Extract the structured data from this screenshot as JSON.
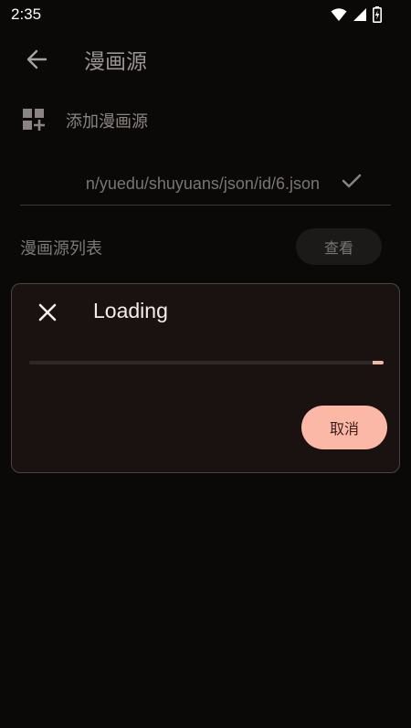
{
  "status_bar": {
    "time": "2:35",
    "icons": [
      "wifi-icon",
      "signal-icon",
      "battery-charging-icon"
    ]
  },
  "app_bar": {
    "back_icon": "arrow-left-icon",
    "title": "漫画源"
  },
  "add_source": {
    "icon": "add-grid-icon",
    "label": "添加漫画源"
  },
  "url_input": {
    "value": "n/yuedu/shuyuans/json/id/6.json",
    "confirm_icon": "check-icon"
  },
  "source_list": {
    "label": "漫画源列表",
    "view_button": "查看"
  },
  "dialog": {
    "close_icon": "close-icon",
    "title": "Loading",
    "progress": 0.97,
    "cancel_button": "取消"
  },
  "colors": {
    "background": "#0a0908",
    "dialog_background": "#191211",
    "accent": "#fbb8a6",
    "progress_indicator": "#f0b7a8"
  }
}
